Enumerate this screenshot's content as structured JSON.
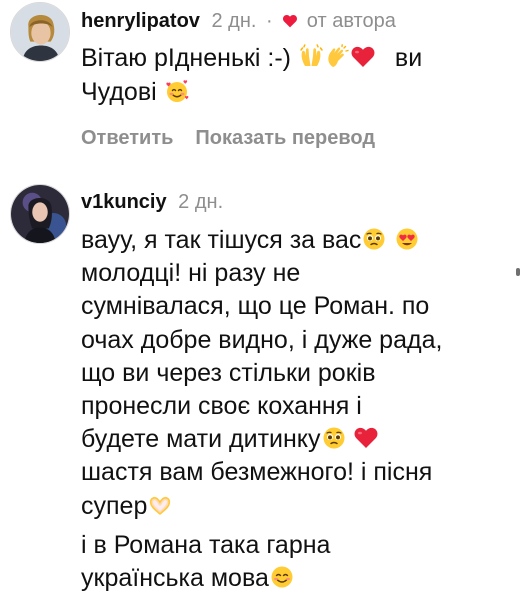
{
  "comments": [
    {
      "username": "henrylipatov",
      "time": "2 дн.",
      "separator": "·",
      "author_like": "от автора",
      "lines": [
        "Вітаю рІдненькі :-)",
        "ви",
        "Чудові"
      ],
      "emojis": [
        "raising-hands",
        "clapping-hands",
        "red-heart",
        "smiling-face-with-hearts"
      ],
      "actions": {
        "reply": "Ответить",
        "translate": "Показать перевод"
      }
    },
    {
      "username": "v1kunciy",
      "time": "2 дн.",
      "paragraphs": [
        {
          "lines": [
            "вауу, я так тішуся за вас",
            "молодці! ні разу не",
            "сумнівалася, що це Роман. по",
            "очах добре видно, і дуже рада,",
            "що ви через стільки років",
            "пронесли своє кохання і",
            "будете мати дитинку",
            "шастя вам безмежного! і пісня",
            "супер"
          ]
        },
        {
          "lines": [
            "і в Романа така гарна",
            "українська мова"
          ]
        }
      ],
      "emojis": [
        "pleading-face",
        "heart-eyes",
        "pleading-face",
        "red-heart",
        "heart-hands",
        "smiling-face"
      ]
    }
  ],
  "colors": {
    "text": "#111111",
    "muted": "#8e8e8e",
    "heart": "#ed1c3f"
  }
}
